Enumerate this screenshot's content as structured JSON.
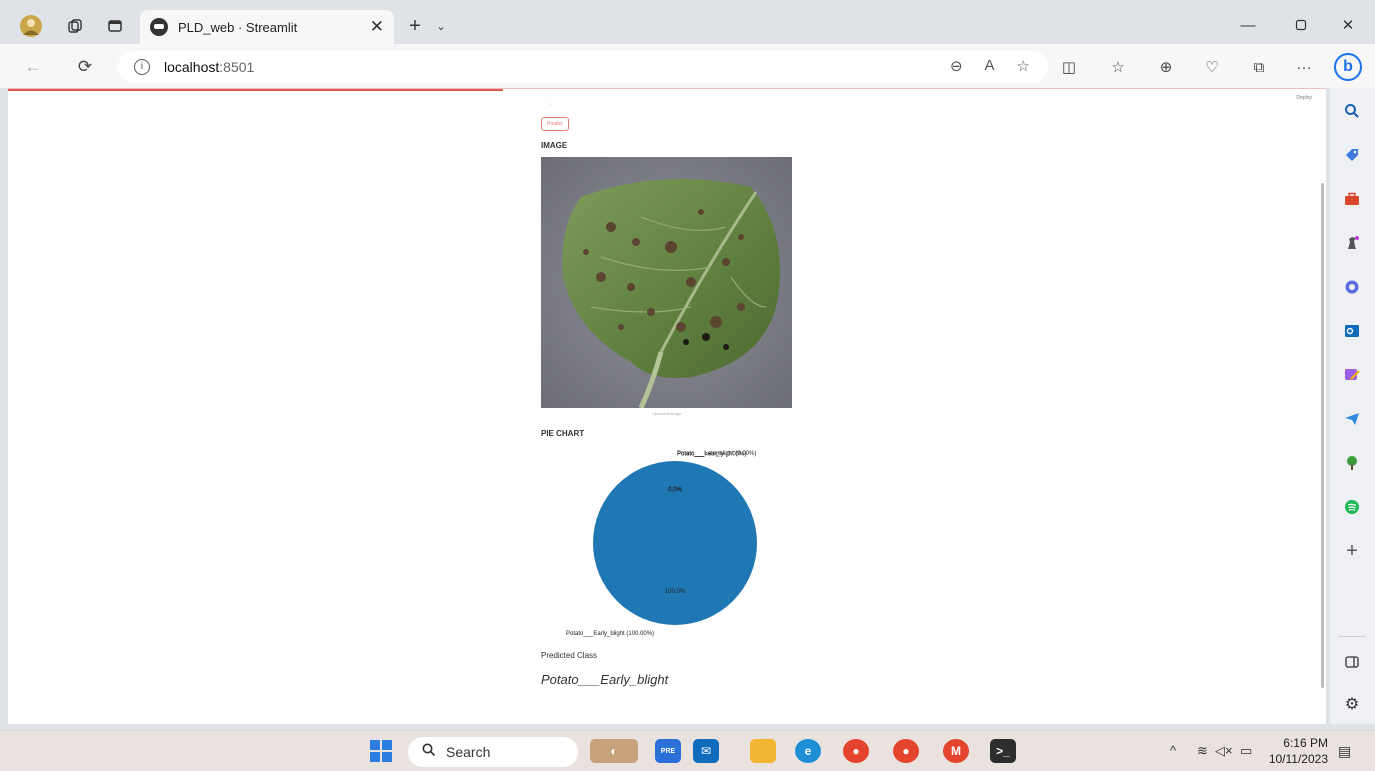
{
  "browser": {
    "tab_title": "PLD_web · Streamlit",
    "url_host": "localhost",
    "url_port": ":8501"
  },
  "app": {
    "deploy_label": "Deploy",
    "predict_button": "Predict",
    "image_heading": "IMAGE",
    "image_caption": "Uploaded Image",
    "pie_heading": "PIE CHART",
    "predicted_heading": "Predicted Class",
    "predicted_value": "Potato___Early_blight"
  },
  "chart_data": {
    "type": "pie",
    "title": "",
    "slices": [
      {
        "label": "Potato___Early_blight (100.00%)",
        "value": 100.0,
        "pct_label": "100.0%",
        "color": "#1f77b4"
      },
      {
        "label": "Potato___Late_blight (0.00%)",
        "value": 0.0,
        "pct_label": "0.0%",
        "color": "#ff7f0e"
      },
      {
        "label": "Potato___healthy (0.00%)",
        "value": 0.0,
        "pct_label": "0.0%",
        "color": "#2ca02c"
      }
    ]
  },
  "taskbar": {
    "search_label": "Search",
    "time": "6:16 PM",
    "date": "10/11/2023"
  },
  "colors": {
    "accent": "#e0564f",
    "pie_primary": "#1f77b4"
  }
}
